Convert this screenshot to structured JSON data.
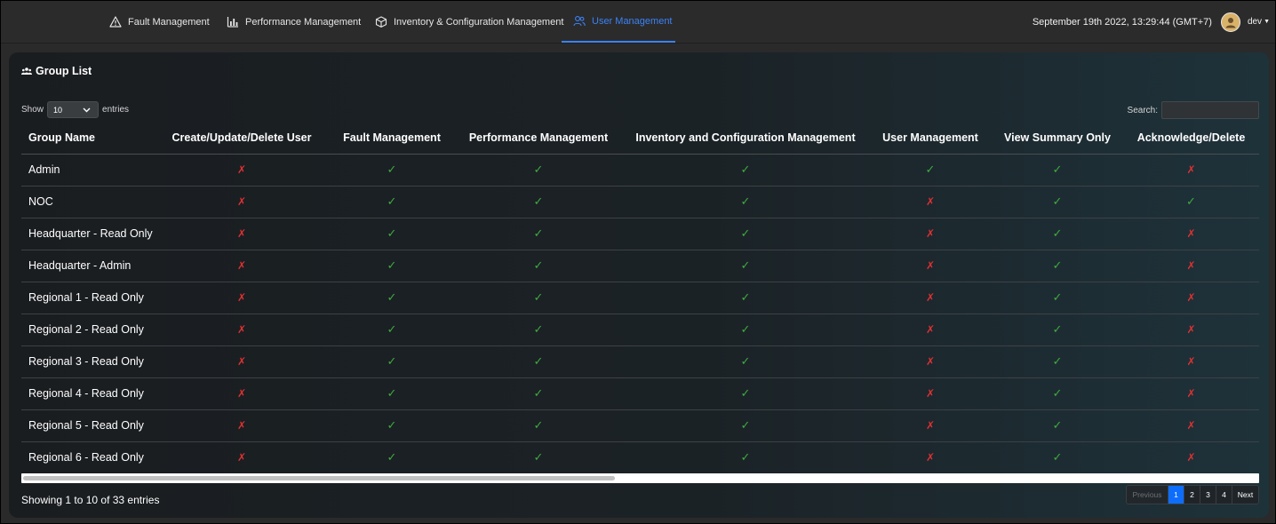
{
  "nav": {
    "items": [
      {
        "label": "Fault Management",
        "icon": "warning-triangle-icon",
        "active": false
      },
      {
        "label": "Performance Management",
        "icon": "bar-chart-icon",
        "active": false
      },
      {
        "label": "Inventory & Configuration Management",
        "icon": "box-icon",
        "active": false
      },
      {
        "label": "User Management",
        "icon": "users-icon",
        "active": true
      }
    ],
    "datetime": "September 19th 2022, 13:29:44 (GMT+7)",
    "username": "dev",
    "accent_color": "#3b82f6"
  },
  "panel": {
    "title": "Group List",
    "length": {
      "show_label": "Show",
      "value": "10",
      "entries_label": "entries"
    },
    "search": {
      "label": "Search:",
      "value": ""
    },
    "columns": [
      "Group Name",
      "Create/Update/Delete User",
      "Fault Management",
      "Performance Management",
      "Inventory and Configuration Management",
      "User Management",
      "View Summary Only",
      "Acknowledge/Delete"
    ],
    "rows": [
      {
        "name": "Admin",
        "perms": [
          false,
          true,
          true,
          true,
          true,
          true,
          false
        ]
      },
      {
        "name": "NOC",
        "perms": [
          false,
          true,
          true,
          true,
          false,
          true,
          true
        ]
      },
      {
        "name": "Headquarter - Read Only",
        "perms": [
          false,
          true,
          true,
          true,
          false,
          true,
          false
        ]
      },
      {
        "name": "Headquarter - Admin",
        "perms": [
          false,
          true,
          true,
          true,
          false,
          true,
          false
        ]
      },
      {
        "name": "Regional 1 - Read Only",
        "perms": [
          false,
          true,
          true,
          true,
          false,
          true,
          false
        ]
      },
      {
        "name": "Regional 2 - Read Only",
        "perms": [
          false,
          true,
          true,
          true,
          false,
          true,
          false
        ]
      },
      {
        "name": "Regional 3 - Read Only",
        "perms": [
          false,
          true,
          true,
          true,
          false,
          true,
          false
        ]
      },
      {
        "name": "Regional 4 - Read Only",
        "perms": [
          false,
          true,
          true,
          true,
          false,
          true,
          false
        ]
      },
      {
        "name": "Regional 5 - Read Only",
        "perms": [
          false,
          true,
          true,
          true,
          false,
          true,
          false
        ]
      },
      {
        "name": "Regional 6 - Read Only",
        "perms": [
          false,
          true,
          true,
          true,
          false,
          true,
          false
        ]
      }
    ],
    "symbols": {
      "yes": "✓",
      "no": "✗"
    },
    "colors": {
      "yes": "#3faa3f",
      "no": "#e03131"
    },
    "info": "Showing 1 to 10 of 33 entries",
    "pagination": {
      "previous": "Previous",
      "pages": [
        "1",
        "2",
        "3",
        "4"
      ],
      "active_page": "1",
      "next": "Next"
    }
  }
}
